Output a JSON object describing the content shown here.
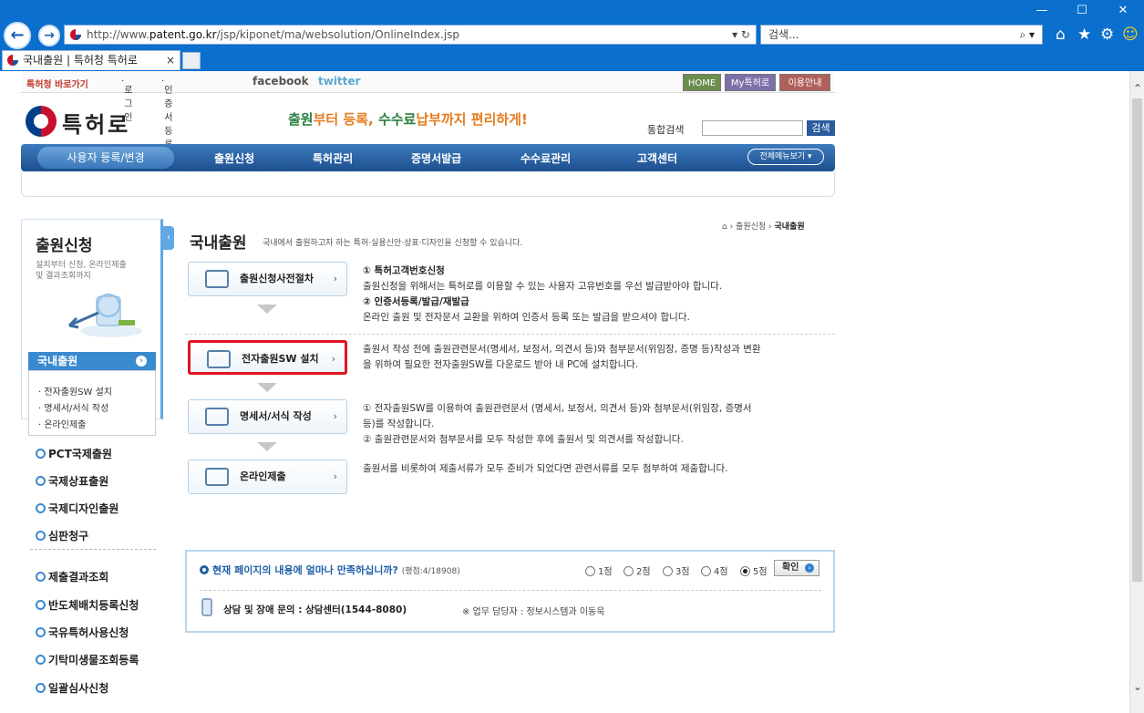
{
  "browser": {
    "url_prefix": "http://www.",
    "url_domain": "patent.go.kr",
    "url_path": "/jsp/kiponet/ma/websolution/OnlineIndex.jsp",
    "search_placeholder": "검색...",
    "tab_title": "국내출원 | 특허청 특허로",
    "window_controls": {
      "minimize": "—",
      "maximize": "☐",
      "close": "✕"
    }
  },
  "topbar": {
    "patent_office_link": "특허청 바로가기",
    "login": "로그인",
    "cert_register": "인증서등록",
    "facebook": "facebook",
    "twitter": "twitter",
    "home": "HOME",
    "my": "My특허로",
    "guide": "이용안내"
  },
  "header": {
    "logo": "특허로",
    "slogan_a": "출원",
    "slogan_b": "부터 등록, ",
    "slogan_c": "수수료",
    "slogan_d": "납부까지 편리하게!",
    "integrated_search_label": "통합검색",
    "search_button": "검색"
  },
  "gnb": {
    "items": [
      "사용자 등록/변경",
      "출원신청",
      "특허관리",
      "증명서발급",
      "수수료관리",
      "고객센터"
    ],
    "all_menu": "전체메뉴보기"
  },
  "sidebar": {
    "title": "출원신청",
    "desc_1": "설치부터 신청, 온라인제출",
    "desc_2": "및 결과조회까지",
    "active": "국내출원",
    "sub": [
      "전자출원SW 설치",
      "명세서/서식 작성",
      "온라인제출"
    ],
    "menu": [
      "PCT국제출원",
      "국제상표출원",
      "국제디자인출원",
      "심판청구",
      "제출결과조회",
      "반도체배치등록신청",
      "국유특허사용신청",
      "기탁미생물조회등록",
      "일괄심사신청"
    ]
  },
  "main": {
    "title": "국내출원",
    "desc": "국내에서 출원하고자 하는 특허·실용신안·상표·디자인을 신청할 수 있습니다.",
    "breadcrumb_parent": "출원신청",
    "breadcrumb_current": "국내출원",
    "steps": [
      {
        "label": "출원신청사전절차"
      },
      {
        "label": "전자출원SW 설치"
      },
      {
        "label": "명세서/서식 작성"
      },
      {
        "label": "온라인제출"
      }
    ],
    "step1_h1": "① 특허고객번호신청",
    "step1_t1": "출원신청을 위해서는 특허로를 이용할 수 있는 사용자 고유번호를 우선 발급받아야 합니다.",
    "step1_h2": "② 인증서등록/발급/재발급",
    "step1_t2": "온라인 출원 및 전자문서 교환을 위하여 인증서 등록 또는 발급을 받으셔야 합니다.",
    "step2_t1": "출원서 작성 전에 출원관련문서(명세서, 보정서, 의견서 등)와 첨부문서(위임장, 증명 등)작성과 변환",
    "step2_t2": "을 위하여 필요한 전자출원SW를 다운로드 받아 내 PC에 설치합니다.",
    "step3_t1": "① 전자출원SW를 이용하여 출원관련문서 (명세서, 보정서, 의견서 등)와 첨부문서(위임장, 증명서",
    "step3_t2": "등)를 작성합니다.",
    "step3_t3": "② 출원관련문서와 첨부문서를 모두 작성한 후에 출원서 및 의견서를 작성합니다.",
    "step4_t1": "출원서를 비롯하여 제출서류가 모두 준비가 되었다면 관련서류를 모두 첨부하여 제출합니다."
  },
  "survey": {
    "question": "현재 페이지의 내용에 얼마나 만족하십니까?",
    "average": "(평점:4/18908)",
    "options": [
      "1점",
      "2점",
      "3점",
      "4점",
      "5점"
    ],
    "selected": "5점",
    "confirm": "확인",
    "contact": "상담 및 장애 문의 : 상담센터(1544-8080)",
    "staff": "※ 업무 담당자 : 정보시스템과 이동욱"
  }
}
